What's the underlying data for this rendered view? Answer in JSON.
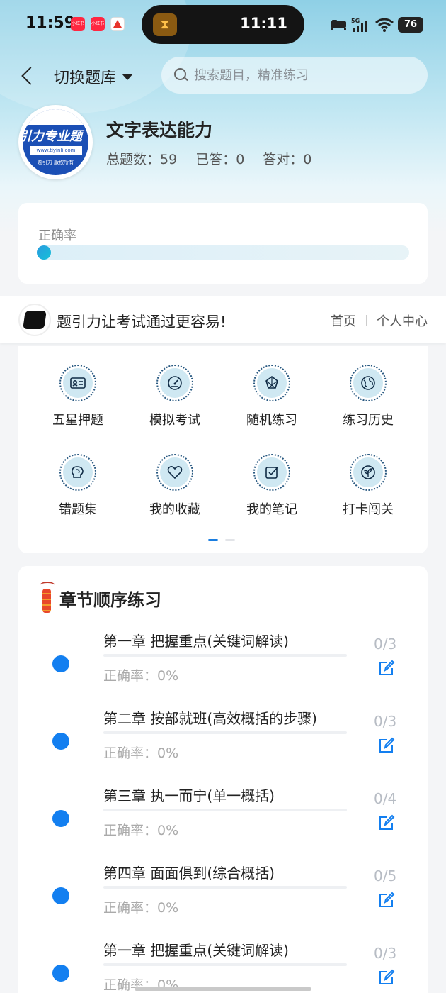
{
  "status_bar": {
    "time": "11:59",
    "island_time": "11:11",
    "battery": "76",
    "network": "5G",
    "apps": [
      "小红书",
      "小红书",
      "百度"
    ]
  },
  "nav": {
    "switch_label": "切换题库",
    "search_placeholder": "搜索题目，精准练习"
  },
  "bank": {
    "logo_title": "引力专业题",
    "logo_url": "www.tiyinli.com",
    "logo_sub": "题引力 版权所有",
    "title": "文字表达能力",
    "total_label": "总题数：59",
    "answered_label": "已答：0",
    "correct_label": "答对：0"
  },
  "accuracy": {
    "label": "正确率",
    "value_fraction": 0
  },
  "banner": {
    "slogan": "题引力让考试通过更容易!",
    "link_home": "首页",
    "link_profile": "个人中心"
  },
  "features": [
    {
      "label": "五星押题",
      "icon": "id-card-icon"
    },
    {
      "label": "模拟考试",
      "icon": "gauge-icon"
    },
    {
      "label": "随机练习",
      "icon": "shuffle-icon"
    },
    {
      "label": "练习历史",
      "icon": "globe-icon"
    },
    {
      "label": "错题集",
      "icon": "brain-icon"
    },
    {
      "label": "我的收藏",
      "icon": "heart-icon"
    },
    {
      "label": "我的笔记",
      "icon": "note-icon"
    },
    {
      "label": "打卡闯关",
      "icon": "leaf-icon"
    }
  ],
  "chapters_section": {
    "title": "章节顺序练习",
    "items": [
      {
        "name": "第一章 把握重点(关键词解读)",
        "accuracy": "正确率：0%",
        "count": "0/3"
      },
      {
        "name": "第二章 按部就班(高效概括的步骤)",
        "accuracy": "正确率：0%",
        "count": "0/3"
      },
      {
        "name": "第三章 执一而宁(单一概括)",
        "accuracy": "正确率：0%",
        "count": "0/4"
      },
      {
        "name": "第四章 面面俱到(综合概括)",
        "accuracy": "正确率：0%",
        "count": "0/5"
      },
      {
        "name": "第一章 把握重点(关键词解读)",
        "accuracy": "正确率：0%",
        "count": "0/3"
      }
    ]
  },
  "colors": {
    "accent": "#137ff0",
    "header_gradient_top": "#8fd0e6"
  }
}
